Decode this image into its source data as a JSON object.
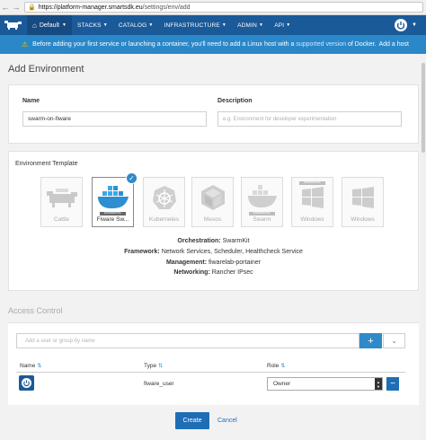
{
  "browser": {
    "url_host": "https://platform-manager.smartsdk.eu",
    "url_path": "/settings/env/add"
  },
  "nav": {
    "environment": "Default",
    "items": [
      "STACKS",
      "CATALOG",
      "INFRASTRUCTURE",
      "ADMIN",
      "API"
    ],
    "brand_color": "#1b5a99"
  },
  "banner": {
    "text_before": "Before adding your first service or launching a container, you'll need to add a Linux host with a",
    "link_supported": "supported version",
    "text_after": "of Docker.",
    "link_add_host": "Add a host"
  },
  "page": {
    "title": "Add Environment"
  },
  "form": {
    "name_label": "Name",
    "name_value": "swarm-on-fiware",
    "description_label": "Description",
    "description_placeholder": "e.g. Environment for developer experimentation"
  },
  "templates": {
    "label": "Environment Template",
    "items": [
      {
        "name": "Cattle",
        "icon": "cattle-icon",
        "tag": ""
      },
      {
        "name": "Fiware Sw...",
        "icon": "swarm-whale-icon",
        "tag": "EXPERIMENTAL"
      },
      {
        "name": "Kubernetes",
        "icon": "kubernetes-icon",
        "tag": ""
      },
      {
        "name": "Mesos",
        "icon": "mesos-icon",
        "tag": ""
      },
      {
        "name": "Swarm",
        "icon": "swarm-icon",
        "tag": "EXPERIMENTAL"
      },
      {
        "name": "Windows",
        "icon": "windows-icon",
        "tag": "EXPERIMENTAL"
      },
      {
        "name": "Windows",
        "icon": "windows-icon",
        "tag": ""
      }
    ],
    "selected_index": 1
  },
  "details": {
    "orchestration_label": "Orchestration:",
    "orchestration": "SwarmKit",
    "framework_label": "Framework:",
    "framework": "Network Services, Scheduler, Healthcheck Service",
    "management_label": "Management:",
    "management": "fiwarelab-portainer",
    "networking_label": "Networking:",
    "networking": "Rancher IPsec"
  },
  "access": {
    "title": "Access Control",
    "search_placeholder": "Add a user or group by name",
    "headers": {
      "name": "Name",
      "type": "Type",
      "role": "Role"
    },
    "rows": [
      {
        "type": "fiware_user",
        "role": "Owner"
      }
    ]
  },
  "actions": {
    "create": "Create",
    "cancel": "Cancel"
  }
}
